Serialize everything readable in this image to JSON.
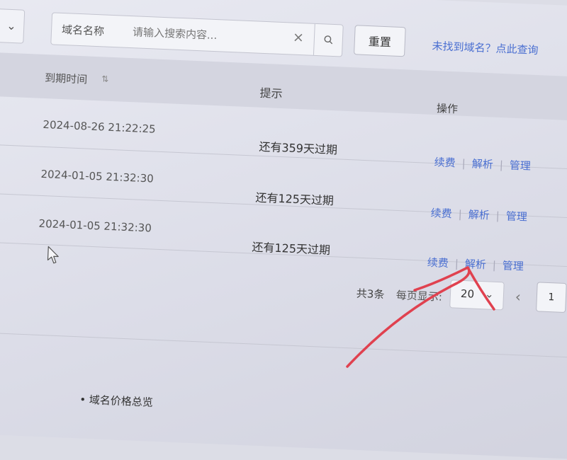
{
  "filter": {
    "search_label": "域名名称",
    "search_placeholder": "请输入搜索内容...",
    "reset_label": "重置",
    "not_found_link": "未找到域名？点此查询"
  },
  "table": {
    "columns": {
      "expire_time": "到期时间",
      "hint": "提示",
      "ops": "操作"
    },
    "rows": [
      {
        "expire_time": "2024-08-26 21:22:25",
        "hint": "还有359天过期",
        "ops": [
          "续费",
          "解析",
          "管理"
        ]
      },
      {
        "expire_time": "2024-01-05 21:32:30",
        "hint": "还有125天过期",
        "ops": [
          "续费",
          "解析",
          "管理"
        ]
      },
      {
        "expire_time": "2024-01-05 21:32:30",
        "hint": "还有125天过期",
        "ops": [
          "续费",
          "解析",
          "管理"
        ]
      }
    ]
  },
  "pagination": {
    "total_text": "共3条",
    "page_size_label": "每页显示:",
    "page_size_value": "20",
    "current_page": "1"
  },
  "footer": {
    "price_overview": "• 域名价格总览"
  },
  "colors": {
    "link": "#4a6fd1",
    "annotation": "#e0414f"
  }
}
